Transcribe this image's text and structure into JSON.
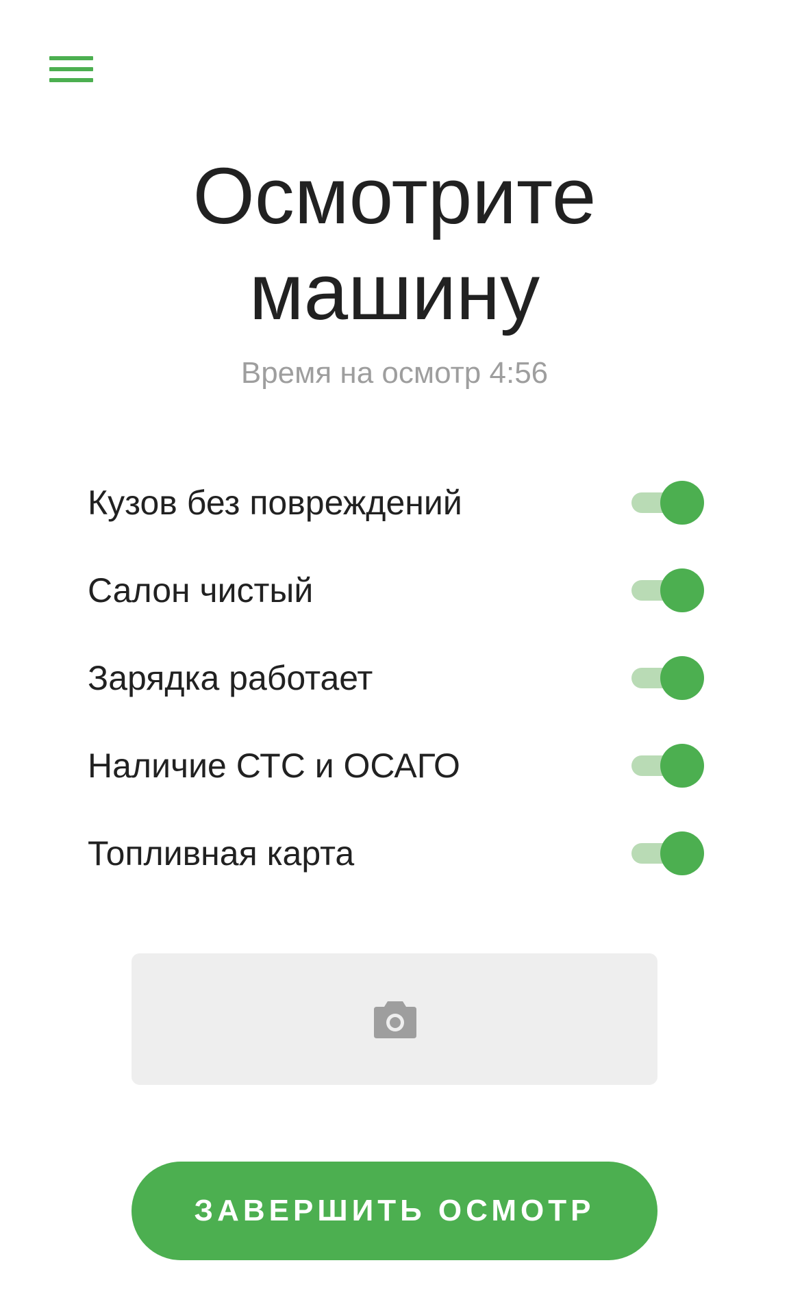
{
  "header": {
    "menu_icon": "hamburger-menu-icon",
    "title_line1": "Осмотрите",
    "title_line2": "машину",
    "subtitle": "Время на осмотр 4:56"
  },
  "checklist": {
    "items": [
      {
        "label": "Кузов без повреждений",
        "checked": true
      },
      {
        "label": "Салон чистый",
        "checked": true
      },
      {
        "label": "Зарядка работает",
        "checked": true
      },
      {
        "label": "Наличие СТС и ОСАГО",
        "checked": true
      },
      {
        "label": "Топливная карта",
        "checked": true
      }
    ]
  },
  "photo": {
    "icon": "camera-icon"
  },
  "actions": {
    "finish_label": "ЗАВЕРШИТЬ ОСМОТР"
  },
  "colors": {
    "accent": "#4caf50",
    "toggle_track": "#b9dbb5",
    "title_text": "#212121",
    "subtitle_text": "#9e9e9e",
    "photo_background": "#eeeeee",
    "camera_icon": "#9e9e9e"
  }
}
